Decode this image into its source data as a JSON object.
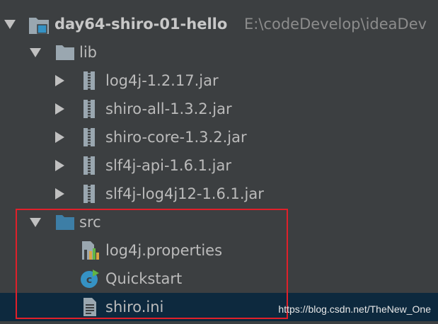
{
  "project": {
    "name": "day64-shiro-01-hello",
    "path": "E:\\codeDevelop\\ideaDev",
    "expanded": true
  },
  "tree": [
    {
      "name": "lib",
      "type": "folder",
      "expanded": true
    },
    {
      "name": "log4j-1.2.17.jar",
      "type": "jar",
      "expanded": false
    },
    {
      "name": "shiro-all-1.3.2.jar",
      "type": "jar",
      "expanded": false
    },
    {
      "name": "shiro-core-1.3.2.jar",
      "type": "jar",
      "expanded": false
    },
    {
      "name": "slf4j-api-1.6.1.jar",
      "type": "jar",
      "expanded": false
    },
    {
      "name": "slf4j-log4j12-1.6.1.jar",
      "type": "jar",
      "expanded": false
    },
    {
      "name": "src",
      "type": "source-folder",
      "expanded": true
    },
    {
      "name": "log4j.properties",
      "type": "properties-file"
    },
    {
      "name": "Quickstart",
      "type": "java-class"
    },
    {
      "name": "shiro.ini",
      "type": "ini-file",
      "selected": true
    }
  ],
  "watermark": "https://blog.csdn.net/TheNew_One",
  "colors": {
    "background": "#3c3f41",
    "selection": "#0d293e",
    "highlight_border": "#e0202a",
    "source_folder": "#3d7ea6",
    "class_icon": "#3592c4"
  }
}
